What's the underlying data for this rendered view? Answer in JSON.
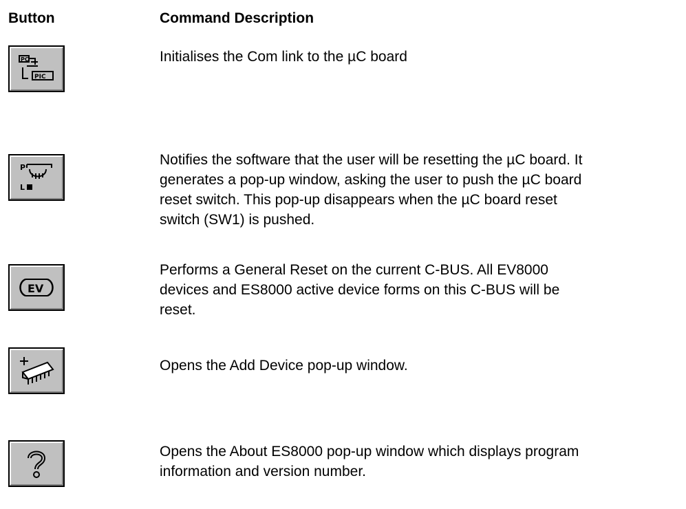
{
  "header": {
    "button_col": "Button",
    "desc_col": "Command Description"
  },
  "rows": [
    {
      "icon": "pc-pic-link-icon",
      "description": "Initialises the Com link to the µC board"
    },
    {
      "icon": "reset-hand-icon",
      "description": "Notifies the software that the user will be resetting the µC board. It\ngenerates a pop-up window, asking the user to push the µC  board\nreset switch.  This pop-up disappears when the µC board reset\nswitch (SW1) is pushed."
    },
    {
      "icon": "ev-general-reset-icon",
      "description": "Performs a General Reset on the current C-BUS.  All EV8000\ndevices and ES8000 active device forms on this C-BUS will be\nreset."
    },
    {
      "icon": "add-device-chip-icon",
      "description": "Opens the Add Device pop-up window."
    },
    {
      "icon": "question-mark-icon",
      "description": "Opens the About ES8000 pop-up window which displays program\ninformation and version number."
    }
  ]
}
